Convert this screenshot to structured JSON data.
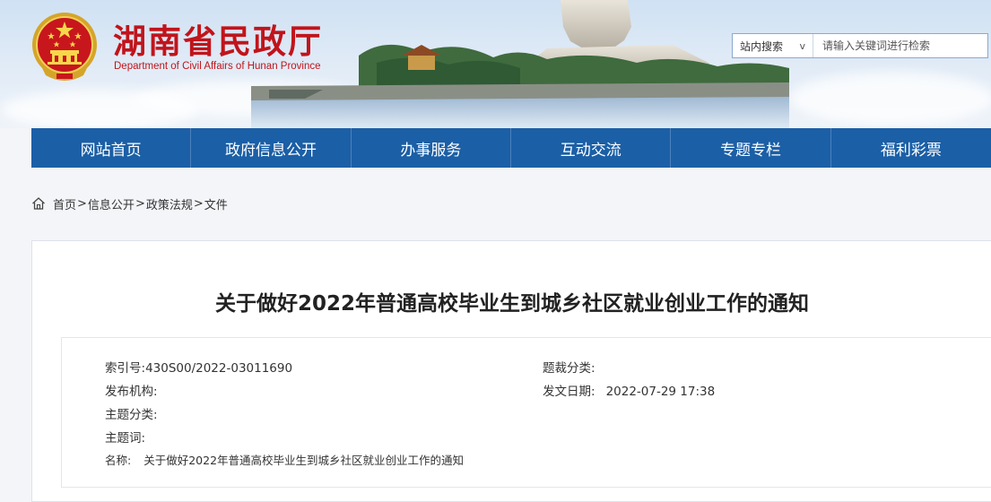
{
  "site": {
    "title": "湖南省民政厅",
    "subtitle": "Department of Civil Affairs of Hunan Province"
  },
  "search": {
    "scope": "站内搜索",
    "scope_chevron": "v",
    "placeholder": "请输入关键词进行检索"
  },
  "nav": {
    "items": [
      {
        "label": "网站首页"
      },
      {
        "label": "政府信息公开"
      },
      {
        "label": "办事服务"
      },
      {
        "label": "互动交流"
      },
      {
        "label": "专题专栏"
      },
      {
        "label": "福利彩票"
      }
    ]
  },
  "breadcrumb": {
    "items": [
      "首页",
      "信息公开",
      "政策法规",
      "文件"
    ],
    "separator": ">"
  },
  "article": {
    "title": "关于做好2022年普通高校毕业生到城乡社区就业创业工作的通知",
    "meta": {
      "index_no_label": "索引号:",
      "index_no_value": "430S00/2022-03011690",
      "genre_label": "题裁分类:",
      "genre_value": "",
      "publisher_label": "发布机构:",
      "publisher_value": "",
      "date_label": "发文日期:",
      "date_value": "2022-07-29 17:38",
      "topic_label": "主题分类:",
      "topic_value": "",
      "keywords_label": "主题词:",
      "keywords_value": "",
      "name_label": "名称:",
      "name_value": "关于做好2022年普通高校毕业生到城乡社区就业创业工作的通知"
    }
  },
  "colors": {
    "brand_red": "#c1141b",
    "nav_blue": "#1b5fa6"
  },
  "icons": {
    "emblem": "national-emblem-icon",
    "home": "home-icon"
  }
}
